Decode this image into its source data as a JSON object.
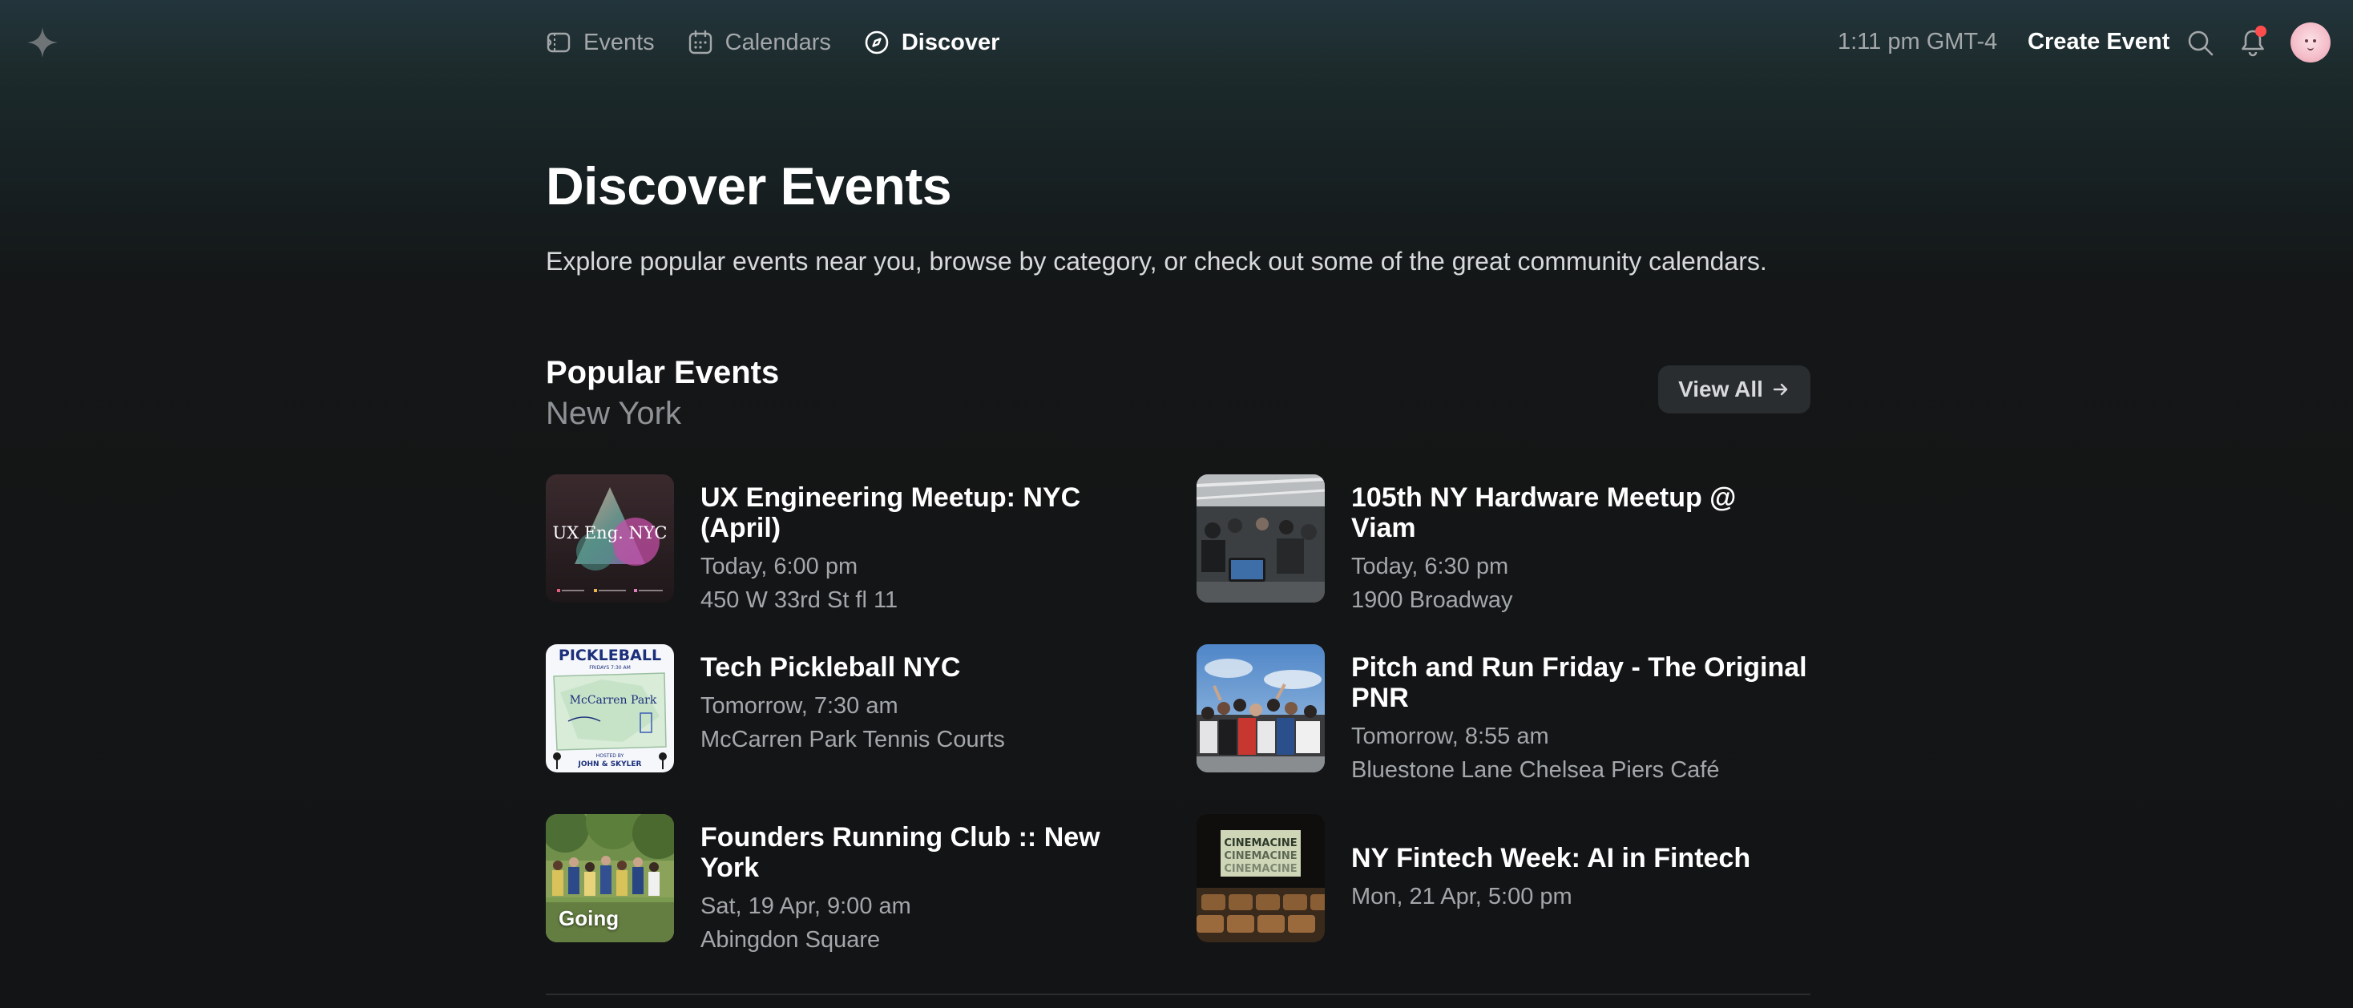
{
  "nav": {
    "items": [
      {
        "label": "Events",
        "icon": "ticket-icon"
      },
      {
        "label": "Calendars",
        "icon": "calendar-icon"
      },
      {
        "label": "Discover",
        "icon": "compass-icon",
        "active": true
      }
    ],
    "time": "1:11 pm GMT-4",
    "create_label": "Create Event"
  },
  "page": {
    "title": "Discover Events",
    "subtitle": "Explore popular events near you, browse by category, or check out some of the great community calendars."
  },
  "popular": {
    "title": "Popular Events",
    "city": "New York",
    "view_all": "View All",
    "events": [
      {
        "title": "UX Engineering Meetup: NYC (April)",
        "time": "Today, 6:00 pm",
        "location": "450 W 33rd St fl 11",
        "thumb_text": "UX Eng. NYC"
      },
      {
        "title": "105th NY Hardware Meetup @ Viam",
        "time": "Today, 6:30 pm",
        "location": "1900 Broadway"
      },
      {
        "title": "Tech Pickleball NYC",
        "time": "Tomorrow, 7:30 am",
        "location": "McCarren Park Tennis Courts",
        "thumb_text": "PICKLEBALL",
        "thumb_sub": "McCarren Park",
        "thumb_host": "JOHN & SKYLER",
        "thumb_time": "FRIDAYS 7:30 AM",
        "thumb_hosted": "HOSTED BY"
      },
      {
        "title": "Pitch and Run Friday - The Original PNR",
        "time": "Tomorrow, 8:55 am",
        "location": "Bluestone Lane Chelsea Piers Café"
      },
      {
        "title": "Founders Running Club :: New York",
        "time": "Sat, 19 Apr, 9:00 am",
        "location": "Abingdon Square",
        "badge": "Going"
      },
      {
        "title": "NY Fintech Week: AI in Fintech",
        "time": "Mon, 21 Apr, 5:00 pm",
        "location": "",
        "thumb_text": "CINEMACINE"
      }
    ]
  }
}
